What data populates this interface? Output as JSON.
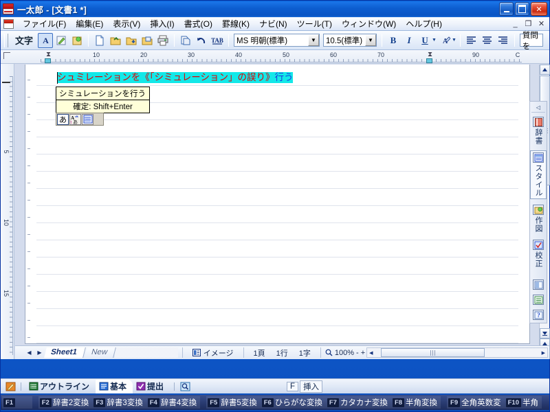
{
  "window": {
    "title": "一太郎 - [文書1 *]",
    "icon": "ichitaro-app-icon",
    "minimize": "_",
    "maximize": "□",
    "close": "✕"
  },
  "menubar": {
    "items": [
      {
        "label": "ファイル(F)"
      },
      {
        "label": "編集(E)"
      },
      {
        "label": "表示(V)"
      },
      {
        "label": "挿入(I)"
      },
      {
        "label": "書式(O)"
      },
      {
        "label": "罫線(K)"
      },
      {
        "label": "ナビ(N)"
      },
      {
        "label": "ツール(T)"
      },
      {
        "label": "ウィンドウ(W)"
      },
      {
        "label": "ヘルプ(H)"
      }
    ],
    "mdi": {
      "minimize": "_",
      "restore": "❐",
      "close": "✕"
    }
  },
  "toolbar": {
    "mode_label": "文字",
    "buttons": [
      {
        "name": "char-style-a-icon",
        "glyph": "A"
      },
      {
        "name": "pen-icon",
        "glyph": "✎"
      },
      {
        "name": "draw-icon",
        "glyph": "●"
      },
      {
        "name": "new-document-icon",
        "glyph": "🗋"
      },
      {
        "name": "open-folder-icon",
        "glyph": "📂"
      },
      {
        "name": "save-folder-icon",
        "glyph": "📁"
      },
      {
        "name": "save-as-icon",
        "glyph": "📁"
      },
      {
        "name": "print-icon",
        "glyph": "🖶"
      },
      {
        "name": "copy-icon",
        "glyph": "🗐"
      },
      {
        "name": "undo-icon",
        "glyph": "↺"
      },
      {
        "name": "tab-icon",
        "glyph": "TAB"
      }
    ],
    "font_name": "MS 明朝(標準)",
    "font_size": "10.5(標準)",
    "bold": "B",
    "italic": "I",
    "underline": "U",
    "highlight": "A",
    "align_left": "▤",
    "align_center": "▤",
    "align_right": "▤",
    "ask_box": "質問を"
  },
  "ruler": {
    "h_numbers": [
      "10",
      "20",
      "30",
      "40",
      "50",
      "60",
      "70",
      "90"
    ],
    "v_numbers": [
      "5",
      "10",
      "15"
    ],
    "corner": "⌐",
    "right_mark": "C"
  },
  "document": {
    "text_segments": [
      {
        "text": "シュミレーションを",
        "color": "red",
        "highlight": true
      },
      {
        "text": "《「シミュレーション」の誤り》",
        "color": "red",
        "highlight": true
      },
      {
        "text": "行う",
        "color": "blue",
        "highlight": true
      }
    ],
    "full_text": "シュミレーションを《「シミュレーション」の誤り》行う"
  },
  "ime_tooltip": {
    "suggestion": "シミュレーションを行う",
    "hint": "確定: Shift+Enter"
  },
  "ime_bar": {
    "buttons": [
      {
        "name": "ime-input-mode-hiragana-icon",
        "glyph": "あ"
      },
      {
        "name": "ime-conversion-mode-icon",
        "glyph": "A"
      },
      {
        "name": "ime-tool-palette-icon",
        "glyph": "▤"
      }
    ]
  },
  "statusbar": {
    "prev_sheet": "◀",
    "next_sheet": "▶",
    "sheets": [
      {
        "label": "Sheet1",
        "active": true
      },
      {
        "label": "New",
        "active": false
      }
    ],
    "view_icon": "image-view-icon",
    "view_label": "イメージ",
    "page": "1頁",
    "line": "1行",
    "column": "1字",
    "zoom_icon": "magnifier-icon",
    "zoom": "100%",
    "zoom_out": "-",
    "zoom_in": "+",
    "hscroll_left": "◀",
    "hscroll_right": "▶"
  },
  "scrollbar": {
    "up": "▲",
    "down": "▼",
    "page_down": "▼",
    "page_up": "▲"
  },
  "right_dock": {
    "collapse": "◁",
    "items": [
      {
        "label": "辞書",
        "icon": "dictionary-icon",
        "glyph": "📕",
        "selected": false
      },
      {
        "label": "スタイル",
        "icon": "style-icon",
        "glyph": "▤",
        "selected": true
      },
      {
        "label": "作図",
        "icon": "drawing-icon",
        "glyph": "●",
        "selected": false
      },
      {
        "label": "校正",
        "icon": "proofread-icon",
        "glyph": "✓",
        "selected": false
      }
    ],
    "extra_icons": [
      {
        "name": "panel-icon-1",
        "glyph": "▥"
      },
      {
        "name": "panel-icon-2",
        "glyph": "▤"
      },
      {
        "name": "help-icon",
        "glyph": "?"
      }
    ]
  },
  "bottom_tabs": {
    "left_icon": {
      "name": "edit-pencil-icon",
      "glyph": "✎"
    },
    "tabs": [
      {
        "label": "アウトライン",
        "icon": "outline-icon",
        "glyph": "▤",
        "active": false
      },
      {
        "label": "基本",
        "icon": "basic-icon",
        "glyph": "▤",
        "active": true
      },
      {
        "label": "提出",
        "icon": "submit-icon",
        "glyph": "✓",
        "active": false
      }
    ],
    "search_icon": {
      "name": "search-icon",
      "glyph": "🔍"
    },
    "mode_key": "F",
    "mode_label": "挿入"
  },
  "function_keys": {
    "groups": [
      {
        "keys": [
          {
            "key": "F1",
            "label": ""
          }
        ]
      },
      {
        "keys": [
          {
            "key": "F2",
            "label": "辞書2変換"
          },
          {
            "key": "F3",
            "label": "辞書3変換"
          },
          {
            "key": "F4",
            "label": "辞書4変換"
          }
        ]
      },
      {
        "keys": [
          {
            "key": "F5",
            "label": "辞書5変換"
          },
          {
            "key": "F6",
            "label": "ひらがな変換"
          },
          {
            "key": "F7",
            "label": "カタカナ変換"
          },
          {
            "key": "F8",
            "label": "半角変換"
          }
        ]
      },
      {
        "keys": [
          {
            "key": "F9",
            "label": "全角英数変"
          },
          {
            "key": "F10",
            "label": "半角"
          }
        ]
      }
    ]
  },
  "colors": {
    "title_blue": "#0d5ed0",
    "highlight_cyan": "#13e8e8",
    "error_red": "#e00000",
    "text_blue": "#1a3ae0",
    "tooltip_yellow": "#ffffd9",
    "fkey_navy": "#2a3c72"
  }
}
